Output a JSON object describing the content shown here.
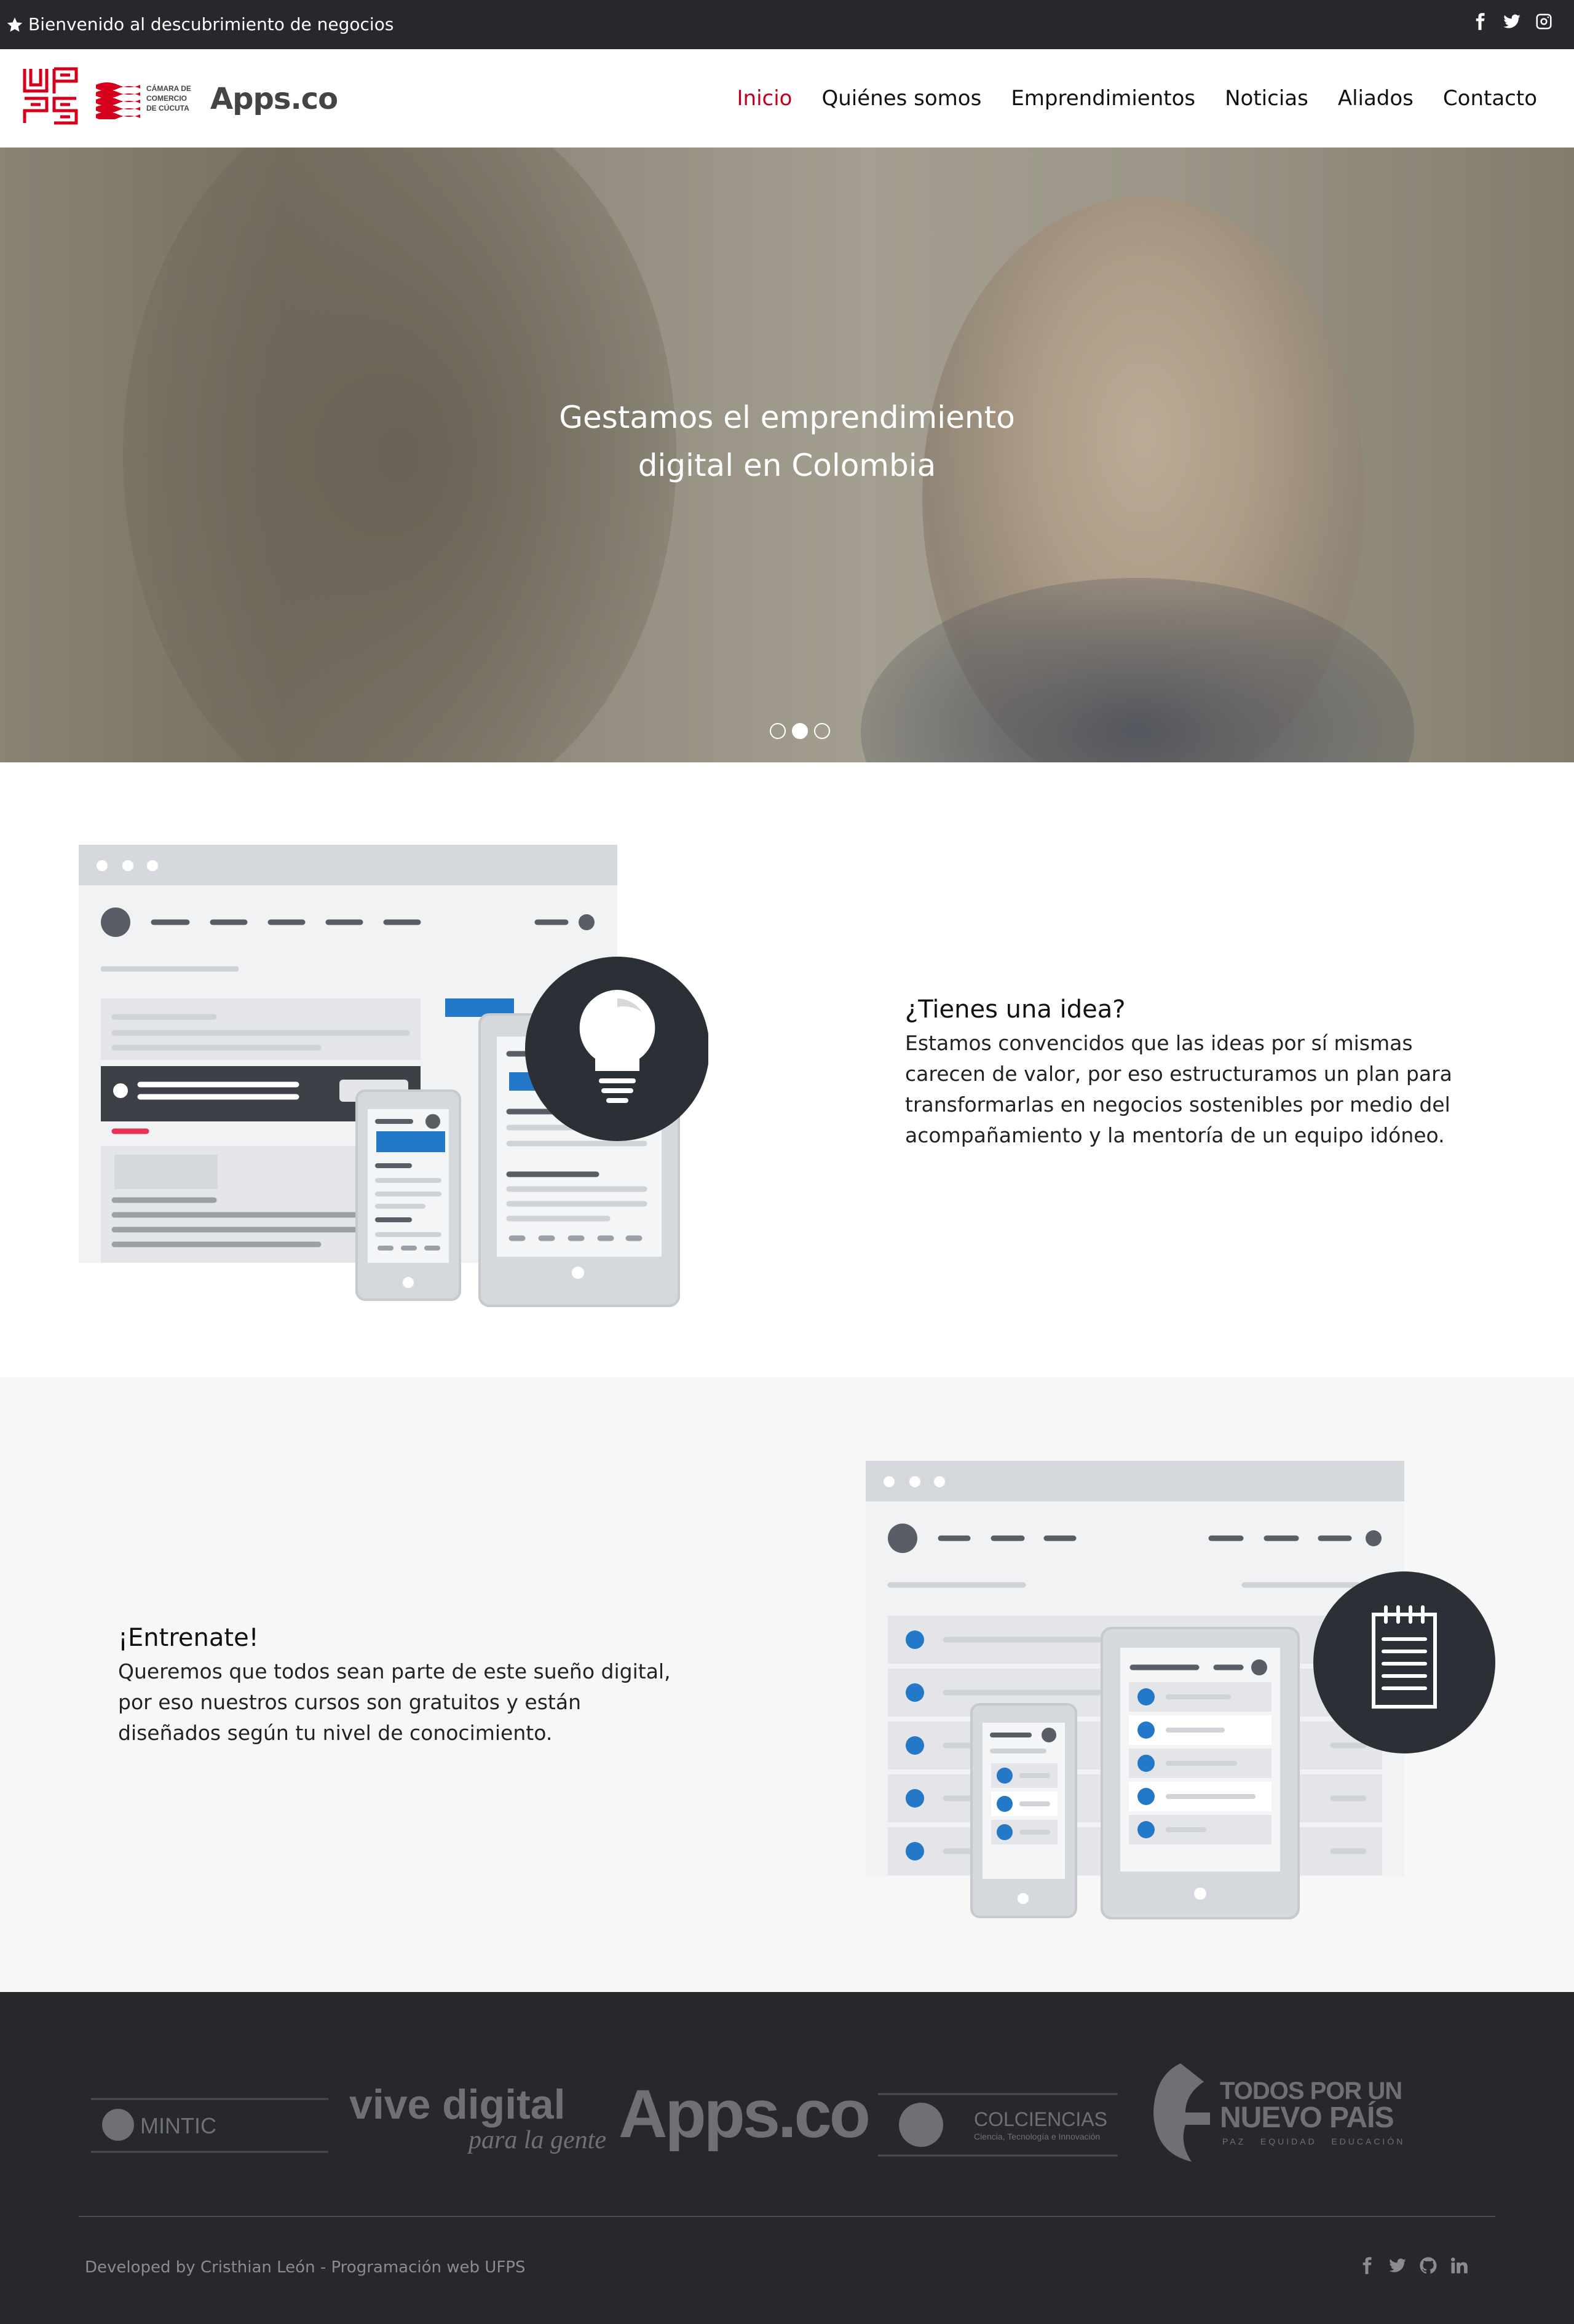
{
  "topbar": {
    "welcome": "Bienvenido al descubrimiento de negocios",
    "social_icons": [
      "facebook-icon",
      "twitter-icon",
      "instagram-icon"
    ]
  },
  "header": {
    "logos": {
      "ufps": "UFPS",
      "camara_line1": "CÁMARA DE",
      "camara_line2": "COMERCIO",
      "camara_line3": "DE CÚCUTA",
      "apps": "Apps.co"
    },
    "nav": [
      {
        "label": "Inicio",
        "active": true
      },
      {
        "label": "Quiénes somos"
      },
      {
        "label": "Emprendimientos"
      },
      {
        "label": "Noticias"
      },
      {
        "label": "Aliados"
      },
      {
        "label": "Contacto"
      }
    ]
  },
  "hero": {
    "title_line1": "Gestamos el emprendimiento",
    "title_line2": "digital en Colombia",
    "slides": 3,
    "active_slide": 2
  },
  "idea": {
    "title": "¿Tienes una idea?",
    "text": "Estamos convencidos que las ideas por sí mismas carecen de valor, por eso estructuramos un plan para transformarlas en negocios sostenibles por medio del acompañamiento y la mentoría de un equipo idóneo."
  },
  "train": {
    "title": "¡Entrenate!",
    "text": "Queremos que todos sean parte de este sueño digital, por eso nuestros cursos son gratuitos y están diseñados según tu nivel de conocimiento."
  },
  "footer": {
    "partners": {
      "mintic": "MINTIC",
      "vive_digital": "vive digital",
      "vive_digital_sub": "para la gente",
      "apps": "Apps.co",
      "colciencias": "COLCIENCIAS",
      "colciencias_sub": "Ciencia, Tecnología e Innovación",
      "todos_line1": "TODOS POR UN",
      "todos_line2": "NUEVO PAÍS",
      "todos_sub": "PAZ   EQUIDAD   EDUCACIÓN"
    },
    "credits": "Developed by Cristhian León - Programación web UFPS",
    "social_icons": [
      "facebook-icon",
      "twitter-icon",
      "github-icon",
      "linkedin-icon"
    ]
  },
  "colors": {
    "dark": "#26282b",
    "accent": "#c2001e",
    "blue": "#2478c8",
    "gray_bg": "#f7f7f7"
  }
}
